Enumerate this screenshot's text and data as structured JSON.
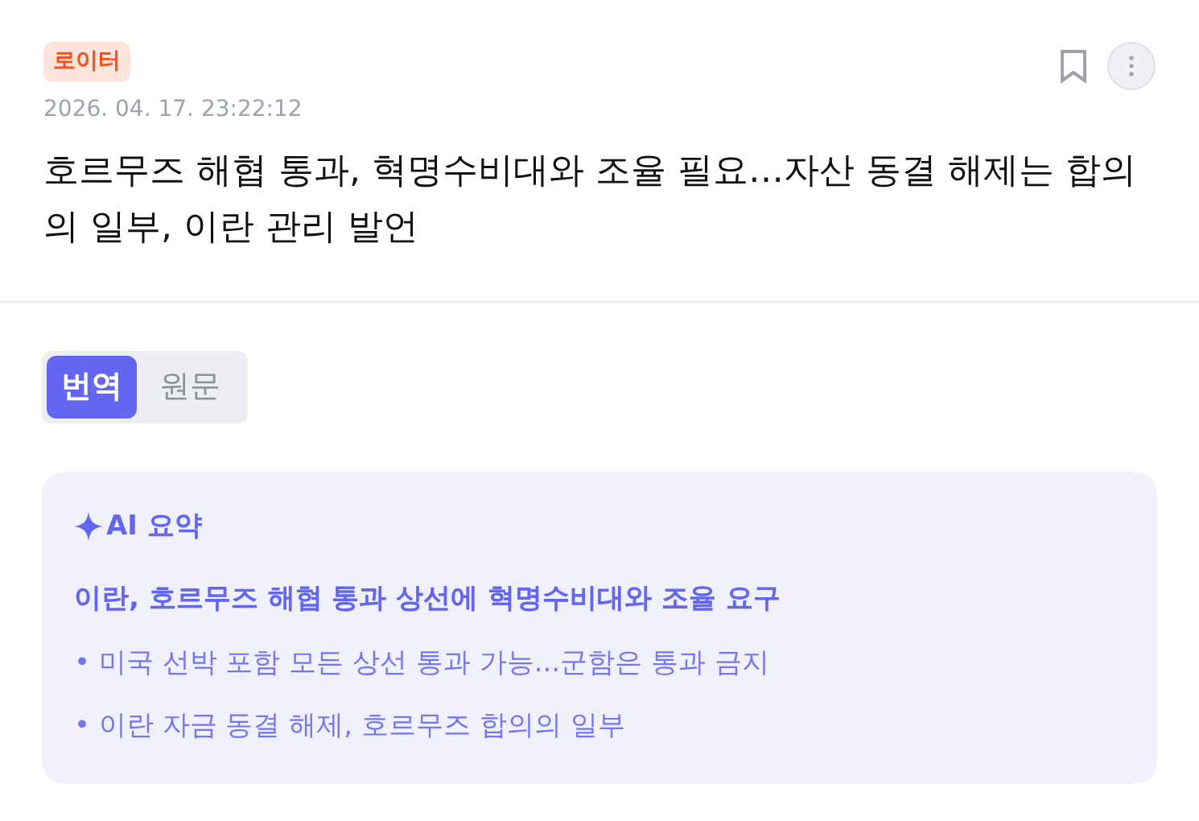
{
  "article": {
    "source": "로이터",
    "timestamp": "2026. 04. 17. 23:22:12",
    "bookmarked": false,
    "title": "호르무즈 해협 통과, 혁명수비대와 조율 필요…자산 동결 해제는 합의의 일부, 이란 관리 발언"
  },
  "tabs": [
    {
      "label": "번역",
      "selected": true
    },
    {
      "label": "원문",
      "selected": false
    }
  ],
  "summary": {
    "label": "AI 요약",
    "headline": "이란, 호르무즈 해협 통과 상선에 혁명수비대와 조율 요구",
    "points": [
      "• 미국 선박 포함 모든 상선 통과 가능...군함은 통과 금지",
      "• 이란 자금 동결 해제, 호르무즈 합의의 일부"
    ]
  }
}
